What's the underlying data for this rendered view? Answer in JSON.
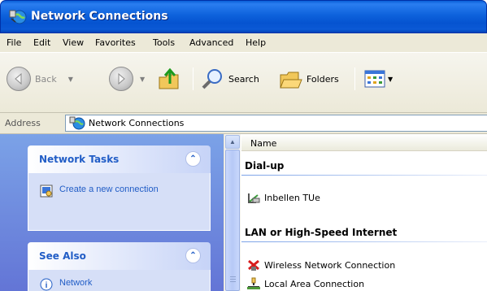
{
  "window": {
    "title": "Network Connections",
    "icon": "network-connections-icon"
  },
  "menu": [
    "File",
    "Edit",
    "View",
    "Favorites",
    "Tools",
    "Advanced",
    "Help"
  ],
  "toolbar": {
    "back_label": "Back",
    "search_label": "Search",
    "folders_label": "Folders"
  },
  "address": {
    "label": "Address",
    "value": "Network Connections"
  },
  "tasks": {
    "network_tasks": {
      "title": "Network Tasks",
      "items": [
        "Create a new connection"
      ]
    },
    "see_also": {
      "title": "See Also",
      "items": [
        "Network"
      ]
    }
  },
  "list": {
    "column_name": "Name",
    "groups": [
      {
        "title": "Dial-up",
        "items": [
          "Inbellen TUe"
        ]
      },
      {
        "title": "LAN or High-Speed Internet",
        "items": [
          "Wireless Network Connection",
          "Local Area Connection"
        ]
      }
    ]
  },
  "colors": {
    "titlebar": "#0553d0",
    "task_link": "#215dc6",
    "task_pane_bg": "#7ba2e7"
  }
}
